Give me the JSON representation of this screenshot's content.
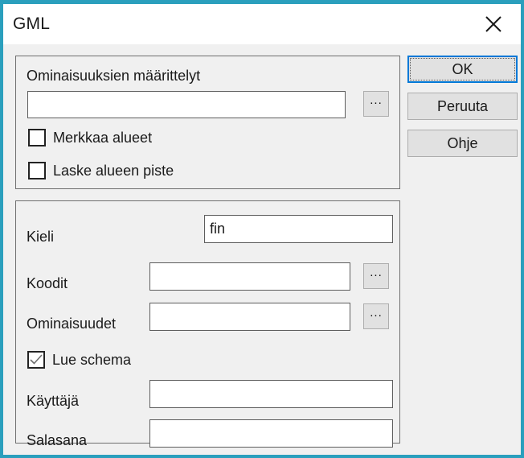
{
  "window": {
    "title": "GML",
    "border_color": "#2a9fbd",
    "background": "#f0f0f0",
    "close_icon": "close-icon"
  },
  "groups": {
    "properties": {
      "field_label": "Ominaisuuksien määrittelyt",
      "field_value": "",
      "field_placeholder": "",
      "browse_label": "...",
      "checkboxes": [
        {
          "label": "Merkkaa alueet",
          "checked": false
        },
        {
          "label": "Laske alueen piste",
          "checked": false
        }
      ]
    },
    "connection": {
      "rows": [
        {
          "label": "Kieli",
          "value": "fin",
          "browse": false
        },
        {
          "label": "Koodit",
          "value": "",
          "browse": true,
          "browse_label": "..."
        },
        {
          "label": "Ominaisuudet",
          "value": "",
          "browse": true,
          "browse_label": "..."
        }
      ],
      "checkbox": {
        "label": "Lue schema",
        "checked": true
      },
      "credentials": [
        {
          "label": "Käyttäjä",
          "value": ""
        },
        {
          "label": "Salasana",
          "value": ""
        }
      ]
    }
  },
  "buttons": {
    "ok": "OK",
    "cancel": "Peruuta",
    "help": "Ohje",
    "default_focus_color": "#0078d7"
  }
}
